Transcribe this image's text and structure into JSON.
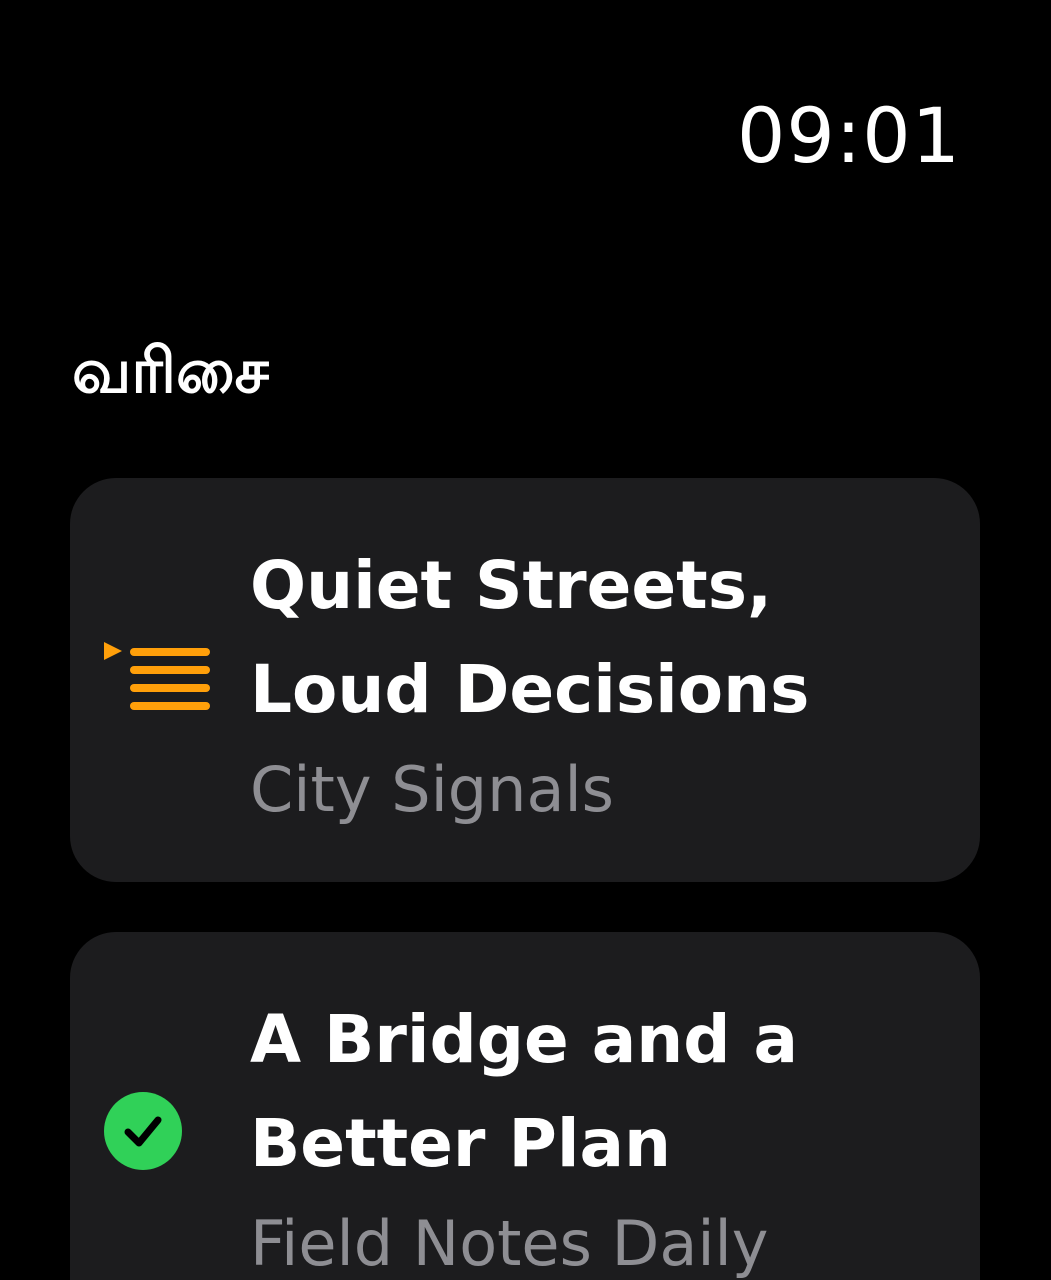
{
  "status": {
    "time": "09:01"
  },
  "page": {
    "title": "வரிசை"
  },
  "colors": {
    "background": "#000000",
    "card": "#1c1c1e",
    "accent_orange": "#ff9f0a",
    "check_green": "#30d158",
    "subtitle_gray": "#8e8e93"
  },
  "queue": [
    {
      "title_line1": "Quiet Streets,",
      "title_line2": "Loud Decisions",
      "show": "City Signals",
      "icon": "now-playing-queue-icon"
    },
    {
      "title_line1": "A Bridge and a",
      "title_line2": "Better Plan",
      "show": "Field Notes Daily",
      "icon": "played-checkmark-icon"
    }
  ]
}
